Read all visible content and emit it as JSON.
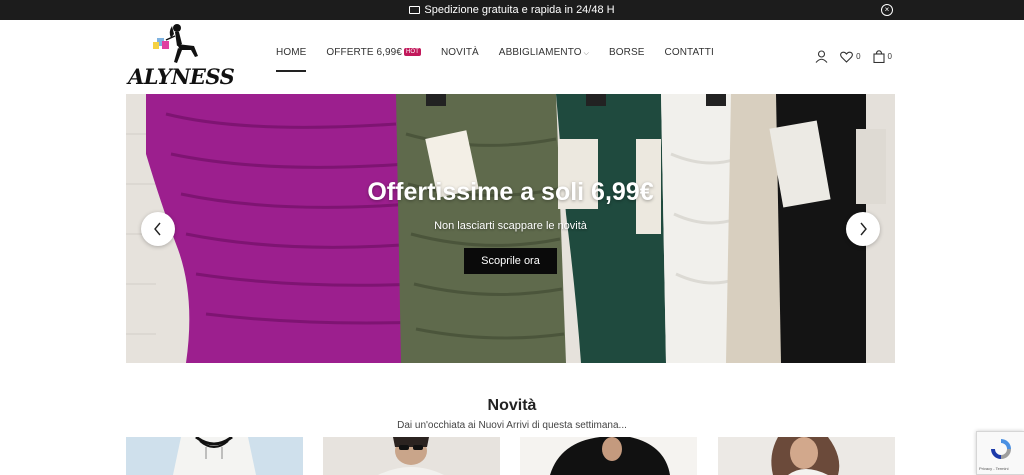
{
  "topbar": {
    "message": "Spedizione gratuita e rapida in 24/48 H",
    "close_symbol": "×",
    "icon": "truck-icon"
  },
  "logo": {
    "text": "ALYNESS"
  },
  "nav": {
    "items": [
      {
        "label": "HOME",
        "active": true
      },
      {
        "label": "OFFERTE 6,99€",
        "badge": "HOT"
      },
      {
        "label": "NOVITÀ"
      },
      {
        "label": "ABBIGLIAMENTO",
        "has_dropdown": true
      },
      {
        "label": "BORSE"
      },
      {
        "label": "CONTATTI"
      }
    ]
  },
  "header_icons": {
    "account_icon": "user-icon",
    "wishlist_icon": "heart-icon",
    "wishlist_count": "0",
    "cart_icon": "shopping-bag-icon",
    "cart_count": "0"
  },
  "hero": {
    "title": "Offertissime a soli 6,99€",
    "subtitle": "Non lasciarti scappare le novità",
    "button_label": "Scoprile ora",
    "prev_icon": "chevron-left-icon",
    "next_icon": "chevron-right-icon"
  },
  "section": {
    "title": "Novità",
    "subtitle": "Dai un'occhiata ai Nuovi Arrivi di questa settimana..."
  },
  "recaptcha": {
    "footer_text": "Privacy - Termini"
  },
  "colors": {
    "topbar_bg": "#1c1c1c",
    "hot_badge": "#c2185b",
    "hero_button": "#0a0a0a",
    "magenta_dress": "#9c1f8e",
    "olive_dress": "#5f6a4c",
    "green_dress": "#1f4a3e",
    "black_dress": "#141414"
  }
}
